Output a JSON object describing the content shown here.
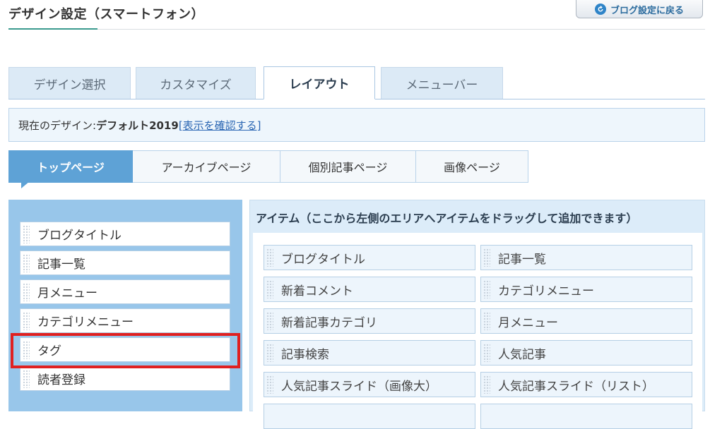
{
  "header": {
    "title": "デザイン設定（スマートフォン）",
    "back_button_label": "ブログ設定に戻る"
  },
  "main_tabs": [
    {
      "label": "デザイン選択",
      "active": false
    },
    {
      "label": "カスタマイズ",
      "active": false
    },
    {
      "label": "レイアウト",
      "active": true
    },
    {
      "label": "メニューバー",
      "active": false
    }
  ],
  "design_info": {
    "prefix": "現在のデザイン: ",
    "design_name": "デフォルト2019",
    "link_label": "[表示を確認する]"
  },
  "sub_tabs": [
    {
      "label": "トップページ",
      "active": true
    },
    {
      "label": "アーカイブページ",
      "active": false
    },
    {
      "label": "個別記事ページ",
      "active": false
    },
    {
      "label": "画像ページ",
      "active": false
    }
  ],
  "layout_area": {
    "items": [
      {
        "label": "ブログタイトル"
      },
      {
        "label": "記事一覧"
      },
      {
        "label": "月メニュー"
      },
      {
        "label": "カテゴリメニュー"
      },
      {
        "label": "タグ",
        "highlighted": true
      },
      {
        "label": "読者登録"
      }
    ]
  },
  "items_panel": {
    "heading": "アイテム（ここから左側のエリアへアイテムをドラッグして追加できます）",
    "items": [
      {
        "label": "ブログタイトル"
      },
      {
        "label": "記事一覧"
      },
      {
        "label": "新着コメント"
      },
      {
        "label": "カテゴリメニュー"
      },
      {
        "label": "新着記事カテゴリ"
      },
      {
        "label": "月メニュー"
      },
      {
        "label": "記事検索"
      },
      {
        "label": "人気記事"
      },
      {
        "label": "人気記事スライド（画像大）"
      },
      {
        "label": "人気記事スライド（リスト）"
      }
    ]
  },
  "colors": {
    "accent": "#5ea2d6",
    "highlight": "#e02020",
    "layout_bg": "#98c6ea"
  }
}
